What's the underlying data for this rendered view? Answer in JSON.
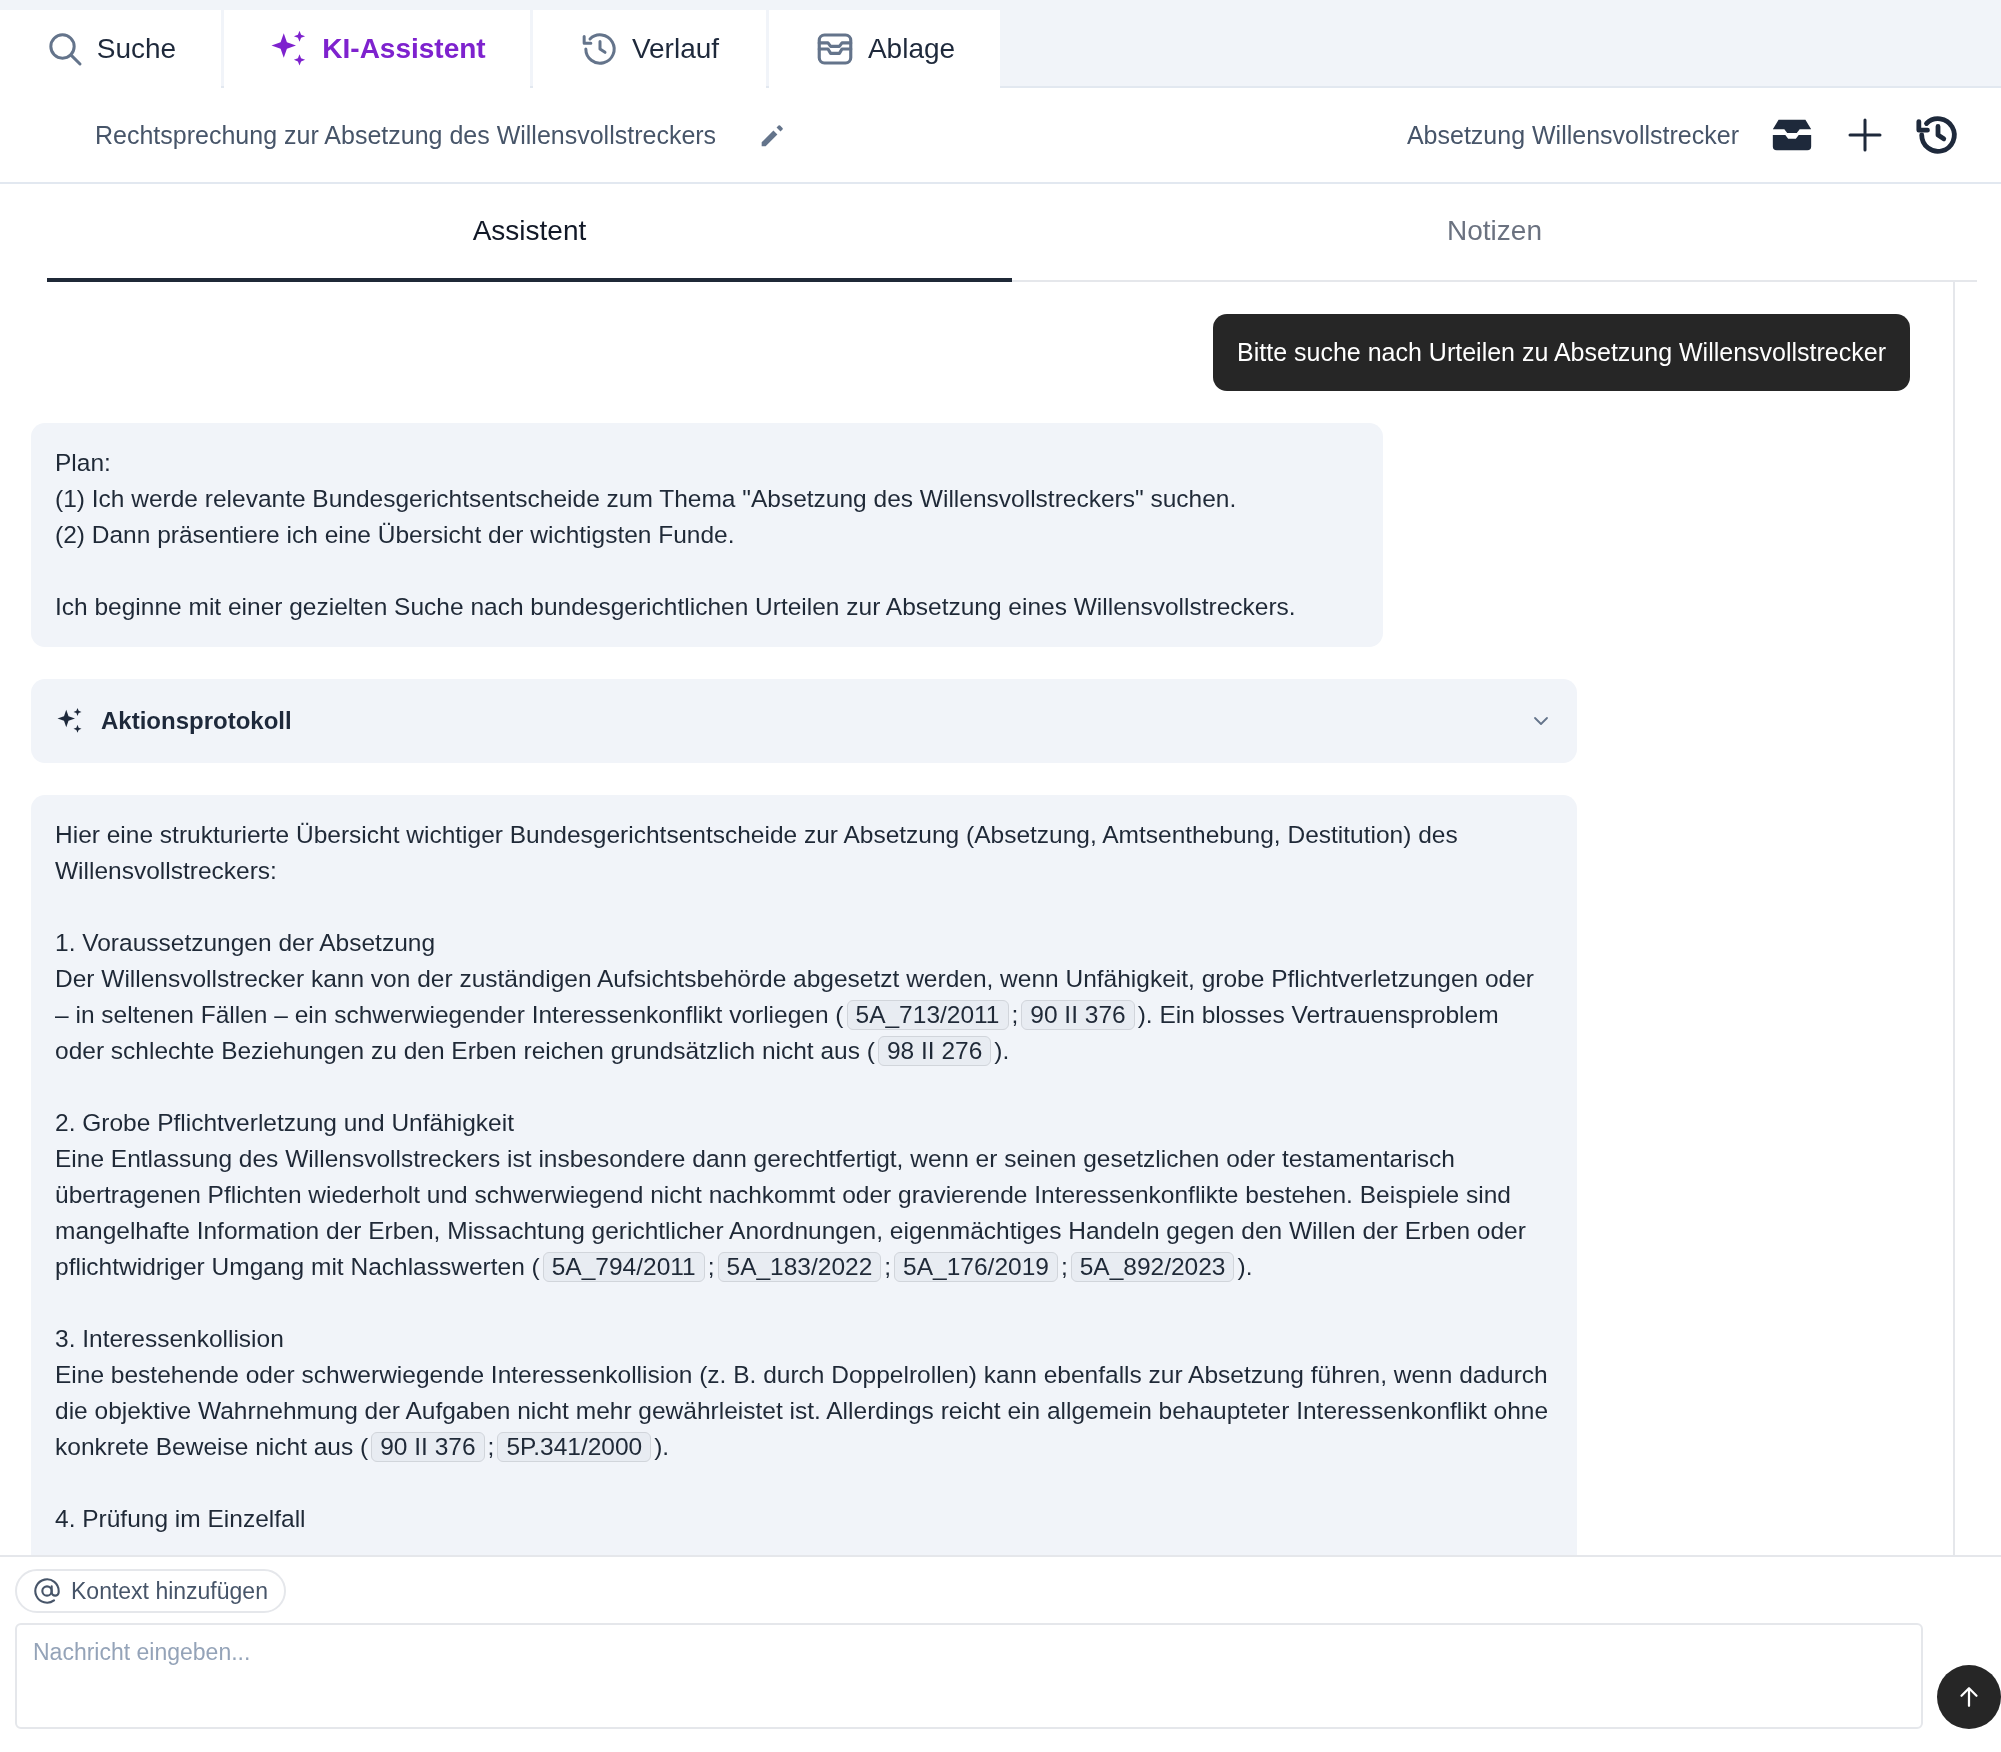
{
  "tabs": [
    {
      "label": "Suche",
      "selected": false
    },
    {
      "label": "KI-Assistent",
      "selected": true
    },
    {
      "label": "Verlauf",
      "selected": false
    },
    {
      "label": "Ablage",
      "selected": false
    }
  ],
  "header": {
    "title": "Rechtsprechung zur Absetzung des Willensvollstreckers",
    "folder": "Absetzung Willensvollstrecker"
  },
  "subtabs": [
    {
      "label": "Assistent",
      "selected": true
    },
    {
      "label": "Notizen",
      "selected": false
    }
  ],
  "messages": [
    {
      "kind": "user",
      "text": "Bitte suche nach Urteilen zu Absetzung Willensvollstrecker"
    },
    {
      "kind": "plan",
      "paragraphs": [
        [
          "Plan:",
          "(1) Ich werde relevante Bundesgerichtsentscheide zum Thema \"Absetzung des Willensvollstreckers\" suchen.",
          "(2) Dann präsentiere ich eine Übersicht der wichtigsten Funde."
        ],
        [
          "Ich beginne mit einer gezielten Suche nach bundesgerichtlichen Urteilen zur Absetzung eines Willensvollstreckers."
        ]
      ]
    },
    {
      "kind": "log",
      "label": "Aktionsprotokoll",
      "expanded": false
    },
    {
      "kind": "answer",
      "blocks": [
        {
          "parts": [
            {
              "kind": "text",
              "text": "Hier eine strukturierte Übersicht wichtiger Bundesgerichtsentscheide zur Absetzung (Absetzung, Amtsenthebung, Destitution) des Willensvollstreckers:"
            }
          ]
        },
        {
          "heading": "1. Voraussetzungen der Absetzung",
          "parts": [
            {
              "kind": "text",
              "text": "Der Willensvollstrecker kann von der zuständigen Aufsichtsbehörde abgesetzt werden, wenn Unfähigkeit, grobe Pflichtverletzungen oder – in seltenen Fällen – ein schwerwiegender Interessenkonflikt vorliegen ("
            },
            {
              "kind": "ref",
              "text": "5A_713/2011"
            },
            {
              "kind": "text",
              "text": ";"
            },
            {
              "kind": "ref",
              "text": "90 II 376"
            },
            {
              "kind": "text",
              "text": "). Ein blosses Vertrauensproblem oder schlechte Beziehungen zu den Erben reichen grundsätzlich nicht aus ("
            },
            {
              "kind": "ref",
              "text": "98 II 276"
            },
            {
              "kind": "text",
              "text": ")."
            }
          ]
        },
        {
          "heading": "2. Grobe Pflichtverletzung und Unfähigkeit",
          "parts": [
            {
              "kind": "text",
              "text": "Eine Entlassung des Willensvollstreckers ist insbesondere dann gerechtfertigt, wenn er seinen gesetzlichen oder testamentarisch übertragenen Pflichten wiederholt und schwerwiegend nicht nachkommt oder gravierende Interessenkonflikte bestehen. Beispiele sind mangelhafte Information der Erben, Missachtung gerichtlicher Anordnungen, eigenmächtiges Handeln gegen den Willen der Erben oder pflichtwidriger Umgang mit Nachlasswerten ("
            },
            {
              "kind": "ref",
              "text": "5A_794/2011"
            },
            {
              "kind": "text",
              "text": ";"
            },
            {
              "kind": "ref",
              "text": "5A_183/2022"
            },
            {
              "kind": "text",
              "text": ";"
            },
            {
              "kind": "ref",
              "text": "5A_176/2019"
            },
            {
              "kind": "text",
              "text": ";"
            },
            {
              "kind": "ref",
              "text": "5A_892/2023"
            },
            {
              "kind": "text",
              "text": ")."
            }
          ]
        },
        {
          "heading": "3. Interessenkollision",
          "parts": [
            {
              "kind": "text",
              "text": "Eine bestehende oder schwerwiegende Interessenkollision (z. B. durch Doppelrollen) kann ebenfalls zur Absetzung führen, wenn dadurch die objektive Wahrnehmung der Aufgaben nicht mehr gewährleistet ist. Allerdings reicht ein allgemein behaupteter Interessenkonflikt ohne konkrete Beweise nicht aus ("
            },
            {
              "kind": "ref",
              "text": "90 II 376"
            },
            {
              "kind": "text",
              "text": ";"
            },
            {
              "kind": "ref",
              "text": "5P.341/2000"
            },
            {
              "kind": "text",
              "text": ")."
            }
          ]
        },
        {
          "heading": "4. Prüfung im Einzelfall"
        }
      ]
    }
  ],
  "composer": {
    "context_button": "Kontext hinzufügen",
    "placeholder": "Nachricht eingeben..."
  }
}
